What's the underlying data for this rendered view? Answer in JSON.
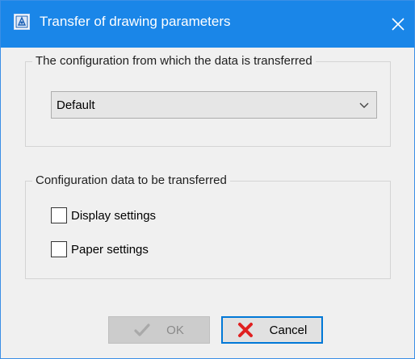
{
  "window": {
    "title": "Transfer of drawing parameters"
  },
  "source_group": {
    "legend": "The configuration from which the data is transferred",
    "combo": {
      "selected": "Default"
    }
  },
  "transfer_group": {
    "legend": "Configuration data to be transferred",
    "options": [
      {
        "label": "Display settings",
        "checked": false
      },
      {
        "label": "Paper settings",
        "checked": false
      }
    ]
  },
  "buttons": {
    "ok_label": "OK",
    "ok_enabled": false,
    "cancel_label": "Cancel"
  },
  "colors": {
    "titlebar": "#1a86e8",
    "focus_border": "#0078d7",
    "cancel_icon": "#e02020"
  },
  "icons": {
    "app": "drawing-parameters-icon",
    "close": "close-icon",
    "dropdown": "chevron-down-icon",
    "ok": "checkmark-icon",
    "cancel": "red-x-icon"
  }
}
